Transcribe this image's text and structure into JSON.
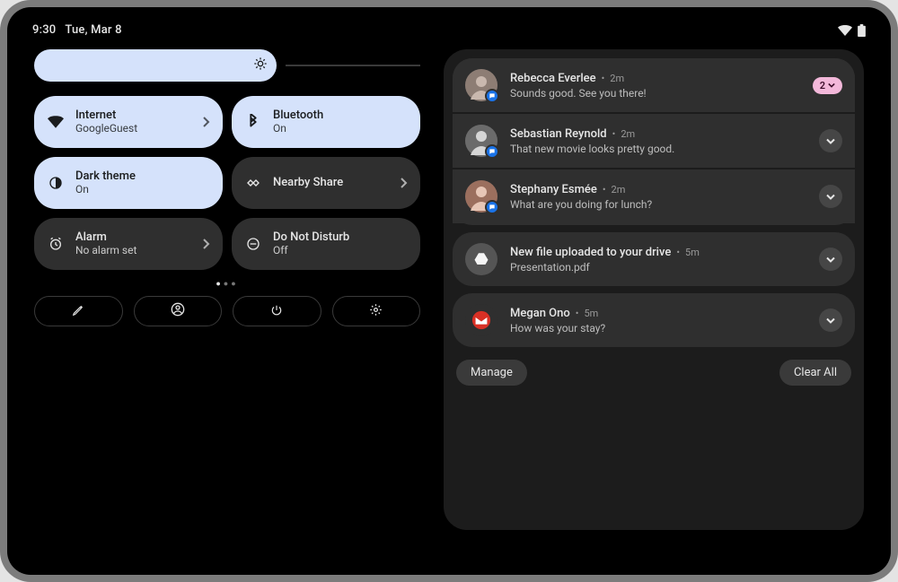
{
  "status": {
    "time": "9:30",
    "date": "Tue, Mar 8"
  },
  "brightness": {
    "level": 0.62
  },
  "tiles": [
    {
      "id": "internet",
      "title": "Internet",
      "sub": "GoogleGuest",
      "active": true,
      "chevron": true,
      "icon": "wifi"
    },
    {
      "id": "bluetooth",
      "title": "Bluetooth",
      "sub": "On",
      "active": true,
      "chevron": false,
      "icon": "bluetooth"
    },
    {
      "id": "darktheme",
      "title": "Dark theme",
      "sub": "On",
      "active": true,
      "chevron": false,
      "icon": "dark"
    },
    {
      "id": "nearby",
      "title": "Nearby Share",
      "sub": "",
      "active": false,
      "chevron": true,
      "icon": "nearby"
    },
    {
      "id": "alarm",
      "title": "Alarm",
      "sub": "No alarm set",
      "active": false,
      "chevron": true,
      "icon": "alarm"
    },
    {
      "id": "dnd",
      "title": "Do Not Disturb",
      "sub": "Off",
      "active": false,
      "chevron": false,
      "icon": "dnd"
    }
  ],
  "notifications": {
    "conversations": [
      {
        "name": "Rebecca Everlee",
        "time": "2m",
        "msg": "Sounds good. See you there!",
        "badge_count": "2"
      },
      {
        "name": "Sebastian Reynold",
        "time": "2m",
        "msg": "That new movie looks pretty good."
      },
      {
        "name": "Stephany Esmée",
        "time": "2m",
        "msg": "What are you doing for lunch?"
      }
    ],
    "other": [
      {
        "app": "drive",
        "name": "New file uploaded to your drive",
        "time": "5m",
        "msg": "Presentation.pdf"
      },
      {
        "app": "gmail",
        "name": "Megan Ono",
        "time": "5m",
        "msg": "How was your stay?"
      }
    ],
    "footer": {
      "manage": "Manage",
      "clear": "Clear All"
    }
  }
}
